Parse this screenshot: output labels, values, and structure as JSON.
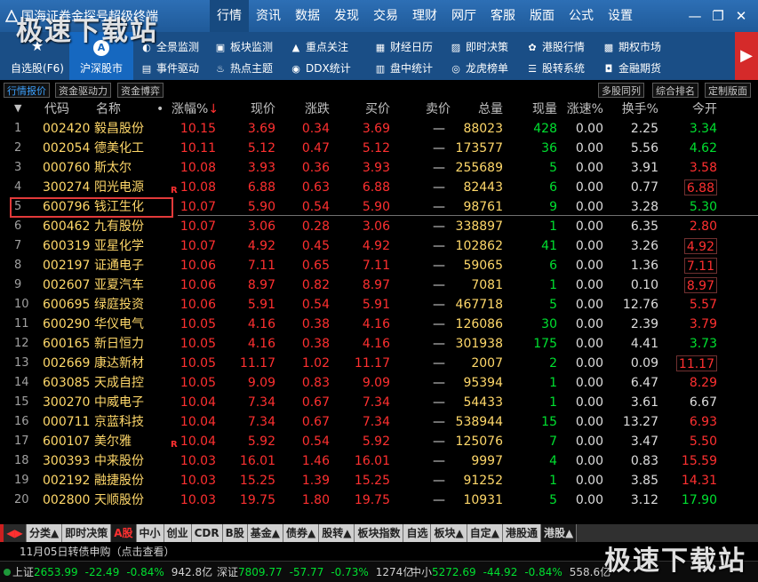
{
  "app": {
    "title": "国海证券金探号超级终端"
  },
  "nav": [
    "行情",
    "资讯",
    "数据",
    "发现",
    "交易",
    "理财",
    "网厅",
    "客服",
    "版面",
    "公式",
    "设置"
  ],
  "nav_active": "行情",
  "window_controls": {
    "minimize": "—",
    "restore": "❐",
    "close": "✕"
  },
  "toolbar": {
    "big": [
      {
        "label": "自选股(F6)",
        "icon": "star-icon",
        "glyph": "★"
      },
      {
        "label": "沪深股市",
        "icon": "a-share-icon",
        "glyph": "A"
      }
    ],
    "small": [
      {
        "label": "全景监测",
        "icon": "monitor-icon",
        "glyph": "◐"
      },
      {
        "label": "事件驱动",
        "icon": "event-icon",
        "glyph": "▤"
      },
      {
        "label": "板块监测",
        "icon": "sector-monitor-icon",
        "glyph": "▣"
      },
      {
        "label": "热点主题",
        "icon": "flame-icon",
        "glyph": "♨"
      },
      {
        "label": "重点关注",
        "icon": "alert-icon",
        "glyph": "▲"
      },
      {
        "label": "DDX统计",
        "icon": "ddx-icon",
        "glyph": "◉"
      },
      {
        "label": "财经日历",
        "icon": "calendar-icon",
        "glyph": "▦"
      },
      {
        "label": "盘中统计",
        "icon": "stats-icon",
        "glyph": "▥"
      },
      {
        "label": "即时决策",
        "icon": "decision-icon",
        "glyph": "▨"
      },
      {
        "label": "龙虎榜单",
        "icon": "dragon-icon",
        "glyph": "◎"
      },
      {
        "label": "港股行情",
        "icon": "globe-icon",
        "glyph": "✿"
      },
      {
        "label": "股转系统",
        "icon": "transfer-icon",
        "glyph": "☰"
      },
      {
        "label": "期权市场",
        "icon": "options-icon",
        "glyph": "▩"
      },
      {
        "label": "金融期货",
        "icon": "futures-icon",
        "glyph": "◘"
      }
    ],
    "more": "▶"
  },
  "subtabs_left": [
    "行情报价",
    "资金驱动力",
    "资金博弈"
  ],
  "subtabs_right": [
    "多股同列",
    "综合排名",
    "定制版面"
  ],
  "columns": {
    "code": "代码",
    "name": "名称",
    "dot": "•",
    "pct": "涨幅%",
    "sort_icon": "↓",
    "price": "现价",
    "change": "涨跌",
    "bid": "买价",
    "ask": "卖价",
    "volume": "总量",
    "cur_vol": "现量",
    "speed": "涨速%",
    "turnover": "换手%",
    "open": "今开"
  },
  "rows": [
    {
      "no": "1",
      "code": "002420",
      "name": "毅昌股份",
      "flag": "",
      "pct": "10.15",
      "price": "3.69",
      "change": "0.34",
      "bid": "3.69",
      "ask": "—",
      "volume": "88023",
      "cur_vol": "428",
      "speed": "0.00",
      "turnover": "2.25",
      "open": "3.34",
      "open_color": "green",
      "open_box": false
    },
    {
      "no": "2",
      "code": "002054",
      "name": "德美化工",
      "flag": "",
      "pct": "10.11",
      "price": "5.12",
      "change": "0.47",
      "bid": "5.12",
      "ask": "—",
      "volume": "173577",
      "cur_vol": "36",
      "speed": "0.00",
      "turnover": "5.56",
      "open": "4.62",
      "open_color": "green",
      "open_box": false
    },
    {
      "no": "3",
      "code": "000760",
      "name": "斯太尔",
      "flag": "",
      "pct": "10.08",
      "price": "3.93",
      "change": "0.36",
      "bid": "3.93",
      "ask": "—",
      "volume": "255689",
      "cur_vol": "5",
      "speed": "0.00",
      "turnover": "3.91",
      "open": "3.58",
      "open_color": "red",
      "open_box": false
    },
    {
      "no": "4",
      "code": "300274",
      "name": "阳光电源",
      "flag": "R",
      "pct": "10.08",
      "price": "6.88",
      "change": "0.63",
      "bid": "6.88",
      "ask": "—",
      "volume": "82443",
      "cur_vol": "6",
      "speed": "0.00",
      "turnover": "0.77",
      "open": "6.88",
      "open_color": "red",
      "open_box": true
    },
    {
      "no": "5",
      "code": "600796",
      "name": "钱江生化",
      "flag": "",
      "pct": "10.07",
      "price": "5.90",
      "change": "0.54",
      "bid": "5.90",
      "ask": "—",
      "volume": "98761",
      "cur_vol": "9",
      "speed": "0.00",
      "turnover": "3.28",
      "open": "5.30",
      "open_color": "green",
      "open_box": false
    },
    {
      "no": "6",
      "code": "600462",
      "name": "九有股份",
      "flag": "",
      "pct": "10.07",
      "price": "3.06",
      "change": "0.28",
      "bid": "3.06",
      "ask": "—",
      "volume": "338897",
      "cur_vol": "1",
      "speed": "0.00",
      "turnover": "6.35",
      "open": "2.80",
      "open_color": "red",
      "open_box": false
    },
    {
      "no": "7",
      "code": "600319",
      "name": "亚星化学",
      "flag": "",
      "pct": "10.07",
      "price": "4.92",
      "change": "0.45",
      "bid": "4.92",
      "ask": "—",
      "volume": "102862",
      "cur_vol": "41",
      "speed": "0.00",
      "turnover": "3.26",
      "open": "4.92",
      "open_color": "red",
      "open_box": true
    },
    {
      "no": "8",
      "code": "002197",
      "name": "证通电子",
      "flag": "",
      "pct": "10.06",
      "price": "7.11",
      "change": "0.65",
      "bid": "7.11",
      "ask": "—",
      "volume": "59065",
      "cur_vol": "6",
      "speed": "0.00",
      "turnover": "1.36",
      "open": "7.11",
      "open_color": "red",
      "open_box": true
    },
    {
      "no": "9",
      "code": "002607",
      "name": "亚夏汽车",
      "flag": "",
      "pct": "10.06",
      "price": "8.97",
      "change": "0.82",
      "bid": "8.97",
      "ask": "—",
      "volume": "7081",
      "cur_vol": "1",
      "speed": "0.00",
      "turnover": "0.10",
      "open": "8.97",
      "open_color": "red",
      "open_box": true
    },
    {
      "no": "10",
      "code": "600695",
      "name": "绿庭投资",
      "flag": "",
      "pct": "10.06",
      "price": "5.91",
      "change": "0.54",
      "bid": "5.91",
      "ask": "—",
      "volume": "467718",
      "cur_vol": "5",
      "speed": "0.00",
      "turnover": "12.76",
      "open": "5.57",
      "open_color": "red",
      "open_box": false
    },
    {
      "no": "11",
      "code": "600290",
      "name": "华仪电气",
      "flag": "",
      "pct": "10.05",
      "price": "4.16",
      "change": "0.38",
      "bid": "4.16",
      "ask": "—",
      "volume": "126086",
      "cur_vol": "30",
      "speed": "0.00",
      "turnover": "2.39",
      "open": "3.79",
      "open_color": "red",
      "open_box": false
    },
    {
      "no": "12",
      "code": "600165",
      "name": "新日恒力",
      "flag": "",
      "pct": "10.05",
      "price": "4.16",
      "change": "0.38",
      "bid": "4.16",
      "ask": "—",
      "volume": "301938",
      "cur_vol": "175",
      "speed": "0.00",
      "turnover": "4.41",
      "open": "3.73",
      "open_color": "green",
      "open_box": false
    },
    {
      "no": "13",
      "code": "002669",
      "name": "康达新材",
      "flag": "",
      "pct": "10.05",
      "price": "11.17",
      "change": "1.02",
      "bid": "11.17",
      "ask": "—",
      "volume": "2007",
      "cur_vol": "2",
      "speed": "0.00",
      "turnover": "0.09",
      "open": "11.17",
      "open_color": "red",
      "open_box": true
    },
    {
      "no": "14",
      "code": "603085",
      "name": "天成自控",
      "flag": "",
      "pct": "10.05",
      "price": "9.09",
      "change": "0.83",
      "bid": "9.09",
      "ask": "—",
      "volume": "95394",
      "cur_vol": "1",
      "speed": "0.00",
      "turnover": "6.47",
      "open": "8.29",
      "open_color": "red",
      "open_box": false
    },
    {
      "no": "15",
      "code": "300270",
      "name": "中威电子",
      "flag": "",
      "pct": "10.04",
      "price": "7.34",
      "change": "0.67",
      "bid": "7.34",
      "ask": "—",
      "volume": "54433",
      "cur_vol": "1",
      "speed": "0.00",
      "turnover": "3.61",
      "open": "6.67",
      "open_color": "white",
      "open_box": false
    },
    {
      "no": "16",
      "code": "000711",
      "name": "京蓝科技",
      "flag": "",
      "pct": "10.04",
      "price": "7.34",
      "change": "0.67",
      "bid": "7.34",
      "ask": "—",
      "volume": "538944",
      "cur_vol": "15",
      "speed": "0.00",
      "turnover": "13.27",
      "open": "6.93",
      "open_color": "red",
      "open_box": false
    },
    {
      "no": "17",
      "code": "600107",
      "name": "美尔雅",
      "flag": "R",
      "pct": "10.04",
      "price": "5.92",
      "change": "0.54",
      "bid": "5.92",
      "ask": "—",
      "volume": "125076",
      "cur_vol": "7",
      "speed": "0.00",
      "turnover": "3.47",
      "open": "5.50",
      "open_color": "red",
      "open_box": false
    },
    {
      "no": "18",
      "code": "300393",
      "name": "中来股份",
      "flag": "",
      "pct": "10.03",
      "price": "16.01",
      "change": "1.46",
      "bid": "16.01",
      "ask": "—",
      "volume": "9997",
      "cur_vol": "4",
      "speed": "0.00",
      "turnover": "0.83",
      "open": "15.59",
      "open_color": "red",
      "open_box": false
    },
    {
      "no": "19",
      "code": "002192",
      "name": "融捷股份",
      "flag": "",
      "pct": "10.03",
      "price": "15.25",
      "change": "1.39",
      "bid": "15.25",
      "ask": "—",
      "volume": "91252",
      "cur_vol": "1",
      "speed": "0.00",
      "turnover": "3.85",
      "open": "14.31",
      "open_color": "red",
      "open_box": false
    },
    {
      "no": "20",
      "code": "002800",
      "name": "天顺股份",
      "flag": "",
      "pct": "10.03",
      "price": "19.75",
      "change": "1.80",
      "bid": "19.75",
      "ask": "—",
      "volume": "10931",
      "cur_vol": "5",
      "speed": "0.00",
      "turnover": "3.12",
      "open": "17.90",
      "open_color": "green",
      "open_box": false
    }
  ],
  "bottom_tabs": [
    "分类▲",
    "即时决策",
    "A股",
    "中小",
    "创业",
    "CDR",
    "B股",
    "基金▲",
    "债券▲",
    "股转▲",
    "板块指数",
    "自选",
    "板块▲",
    "自定▲",
    "港股通",
    "港股▲"
  ],
  "bottom_active": "A股",
  "bottom_arrows": "◀▶",
  "notice": "11月05日转债申购（点击查看）",
  "indices": [
    {
      "label": "上证",
      "value": "2653.99",
      "change": "-22.49",
      "pct": "-0.84%",
      "amount": "942.8亿"
    },
    {
      "label": "深证",
      "value": "7809.77",
      "change": "-57.77",
      "pct": "-0.73%",
      "amount": "1274亿"
    },
    {
      "label": "中小",
      "value": "5272.69",
      "change": "-44.92",
      "pct": "-0.84%",
      "amount": "558.6亿"
    }
  ],
  "colors": {
    "up": "#ff3030",
    "down": "#00e030",
    "stock_name": "#ffd86a",
    "toolbar": "#1a4e86",
    "titlebar": "#2d6fb5"
  },
  "watermarks": [
    "极速下载站",
    "极速下载站"
  ]
}
